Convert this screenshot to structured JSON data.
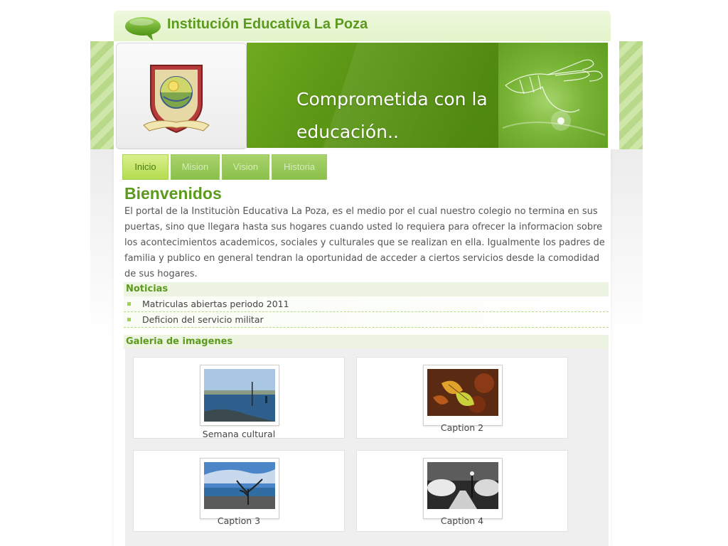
{
  "header": {
    "site_title": "Institución Educativa La Poza"
  },
  "banner": {
    "tagline_line1": "Comprometida con la",
    "tagline_line2": "educación.."
  },
  "nav": {
    "tabs": [
      {
        "label": "Inicio",
        "active": true
      },
      {
        "label": "Mision",
        "active": false
      },
      {
        "label": "Vision",
        "active": false
      },
      {
        "label": "Historia",
        "active": false
      }
    ]
  },
  "welcome": {
    "title": "Bienvenidos",
    "text": "El portal de la Instituciòn Educativa La Poza, es el medio por el cual nuestro colegio no termina en sus puertas, sino que llegara hasta sus hogares cuando usted lo requiera para ofrecer la informacion sobre los acontecimientos academicos, sociales y culturales que se realizan en ella. Igualmente los padres de familia y publico en general tendran la oportunidad de acceder a ciertos servicios desde la comodidad de sus hogares."
  },
  "news": {
    "heading": "Noticias",
    "items": [
      {
        "label": "Matriculas abiertas periodo 2011"
      },
      {
        "label": "Deficion del servicio militar"
      }
    ]
  },
  "gallery": {
    "heading": "Galeria de imagenes",
    "items": [
      {
        "caption": "Semana cultural",
        "image": "seashore-photo"
      },
      {
        "caption": "Caption 2",
        "image": "autumn-leaf-photo"
      },
      {
        "caption": "Caption 3",
        "image": "beach-tree-photo"
      },
      {
        "caption": "Caption 4",
        "image": "snowy-park-photo"
      }
    ]
  },
  "colors": {
    "brand_green": "#5b9a1c",
    "tab_active": "#c5e46a",
    "tab_inactive": "#96c759"
  }
}
